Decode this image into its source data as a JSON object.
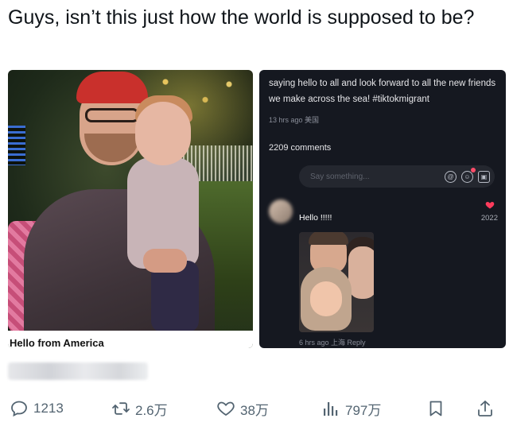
{
  "post": {
    "text": "Guys, isn’t this just how the world is supposed to be?"
  },
  "media": {
    "left_caption": "Hello from America",
    "right": {
      "description": "saying hello to all and look forward to all the new friends we make across the sea!  #tiktokmigrant",
      "meta": "13 hrs ago 美国",
      "comments_count": "2209 comments",
      "comment_placeholder": "Say something...",
      "comment_text": "Hello !!!!!",
      "like_count": "2022",
      "reply_meta": "6 hrs ago 上海 Reply"
    }
  },
  "actions": {
    "replies": "1213",
    "reposts": "2.6万",
    "likes": "38万",
    "views": "797万"
  },
  "colors": {
    "action_gray": "#536471",
    "dark_panel": "#151820",
    "heart_red": "#ff3b5c"
  },
  "icons": [
    "reply-icon",
    "repost-icon",
    "like-icon",
    "views-icon",
    "bookmark-icon",
    "share-icon",
    "at-icon",
    "emoji-icon",
    "image-icon",
    "heart-icon"
  ]
}
